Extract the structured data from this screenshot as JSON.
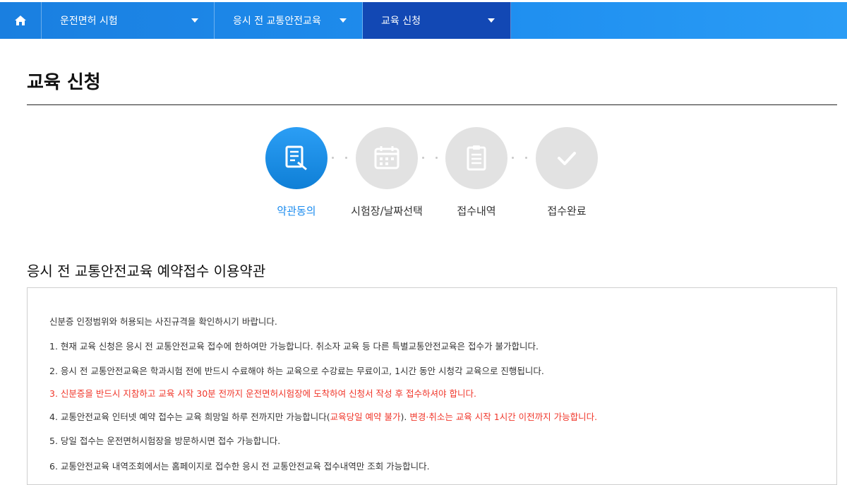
{
  "nav": {
    "items": [
      {
        "label": "운전면허 시험"
      },
      {
        "label": "응시 전 교통안전교육"
      },
      {
        "label": "교육 신청"
      }
    ]
  },
  "page": {
    "title": "교육 신청"
  },
  "steps": [
    {
      "label": "약관동의",
      "icon": "document-edit-icon",
      "active": true
    },
    {
      "label": "시험장/날짜선택",
      "icon": "calendar-icon",
      "active": false
    },
    {
      "label": "접수내역",
      "icon": "clipboard-list-icon",
      "active": false
    },
    {
      "label": "접수완료",
      "icon": "check-icon",
      "active": false
    }
  ],
  "terms": {
    "title": "응시 전 교통안전교육 예약접수 이용약관",
    "intro": "신분증 인정범위와 허용되는 사진규격을 확인하시기 바랍니다.",
    "item1": "1. 현재 교육 신청은 응시 전 교통안전교육 접수에 한하여만 가능합니다. 취소자 교육 등 다른 특별교통안전교육은 접수가 불가합니다.",
    "item2": "2. 응시 전 교통안전교육은 학과시험 전에 반드시 수료해야 하는 교육으로 수강료는 무료이고, 1시간 동안 시청각 교육으로 진행됩니다.",
    "item3": "3. 신분증을 반드시 지참하고 교육 시작 30분 전까지 운전면허시험장에 도착하여 신청서 작성 후 접수하셔야 합니다.",
    "item4_a": "4. 교통안전교육 인터넷 예약 접수는 교육 희망일 하루 전까지만 가능합니다(",
    "item4_b": "교육당일 예약 불가",
    "item4_c": "). ",
    "item4_d": "변경·취소는 교육 시작 1시간 이전까지 가능합니다.",
    "item5": "5. 당일 접수는 운전면허시험장을 방문하시면 접수 가능합니다.",
    "item6": "6. 교통안전교육 내역조회에서는 홈페이지로 접수한 응시 전 교통안전교육 접수내역만 조회 가능합니다."
  },
  "colors": {
    "nav": "#1f8ff0",
    "nav_active": "#1248b4",
    "accent": "#1a8bef",
    "warning": "#f0362a"
  }
}
